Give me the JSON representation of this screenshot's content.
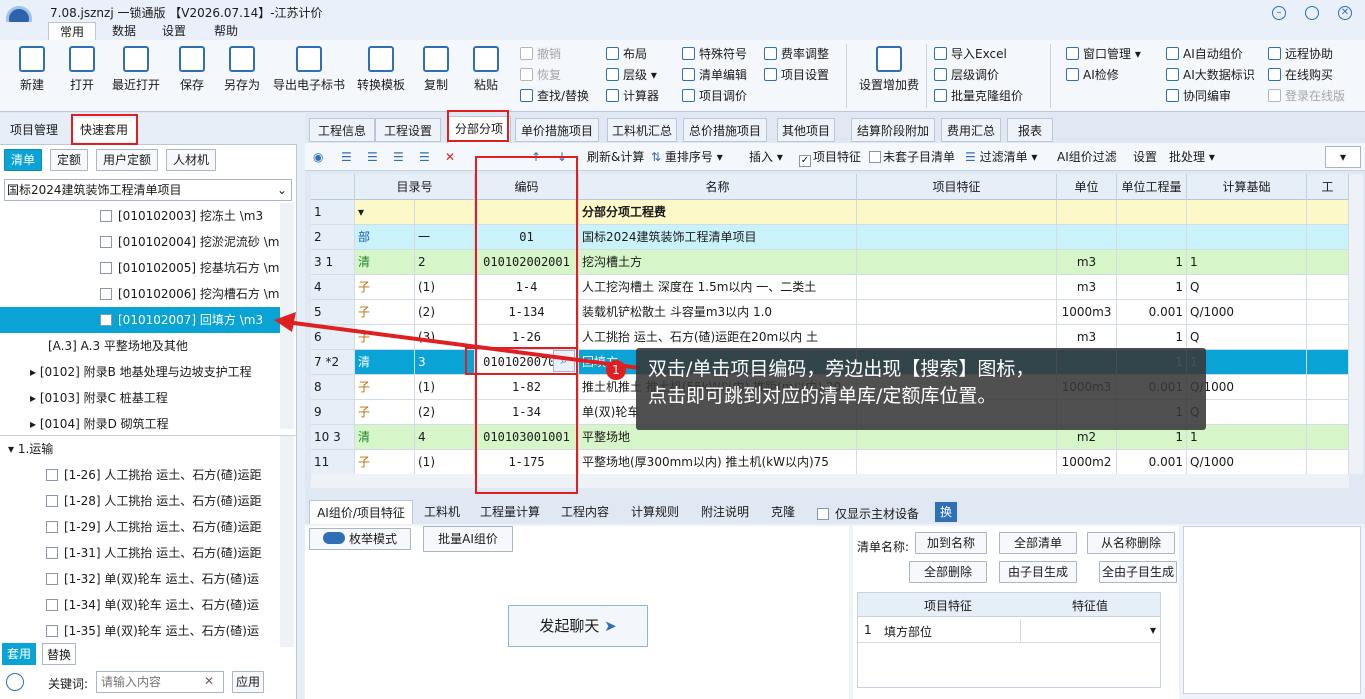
{
  "window": {
    "title": "7.08.jsznzj 一锁通版 【V2026.07.14】-江苏计价"
  },
  "menu": [
    "常用",
    "数据",
    "设置",
    "帮助"
  ],
  "ribbon": {
    "big": [
      "新建",
      "打开",
      "最近打开",
      "保存",
      "另存为",
      "导出电子标书",
      "转换模板",
      "复制",
      "粘贴"
    ],
    "edit": [
      "撤销",
      "恢复",
      "查找/替换"
    ],
    "g2": [
      "布局",
      "层级",
      "计算器"
    ],
    "g3": [
      "特殊符号",
      "清单编辑",
      "项目调价"
    ],
    "g4": [
      "费率调整",
      "项目设置"
    ],
    "add_fee": "设置增加费",
    "g5": [
      "导入Excel",
      "层级调价",
      "批量克隆组价"
    ],
    "g6": [
      "窗口管理",
      "AI检修"
    ],
    "g7": [
      "AI自动组价",
      "AI大数据标识",
      "协同编审"
    ],
    "g8": [
      "远程协助",
      "在线购买",
      "登录在线版"
    ]
  },
  "left": {
    "tabs": [
      "项目管理",
      "快速套用"
    ],
    "subtabs": [
      "清单",
      "定额",
      "用户定额",
      "人材机"
    ],
    "library": "国标2024建筑装饰工程清单项目",
    "tree": [
      "[010102003] 挖冻土 \\m3",
      "[010102004] 挖淤泥流砂 \\m3",
      "[010102005] 挖基坑石方 \\m3",
      "[010102006] 挖沟槽石方 \\m3",
      "[010102007] 回填方 \\m3",
      "[A.3] A.3 平整场地及其他",
      "[0102] 附录B 地基处理与边坡支护工程",
      "[0103] 附录C 桩基工程",
      "[0104] 附录D 砌筑工程"
    ],
    "quota_root": "1.运输",
    "quota": [
      "[1-26] 人工挑抬 运土、石方(碴)运距",
      "[1-28] 人工挑抬 运土、石方(碴)运距",
      "[1-29] 人工挑抬 运土、石方(碴)运距",
      "[1-31] 人工挑抬 运土、石方(碴)运距",
      "[1-32] 单(双)轮车 运土、石方(碴)运",
      "[1-34] 单(双)轮车 运土、石方(碴)运",
      "[1-35] 单(双)轮车 运土、石方(碴)运"
    ],
    "bottom_tabs": [
      "套用",
      "替换"
    ],
    "keyword_label": "关键词:",
    "keyword_placeholder": "请输入内容",
    "clear": "✕",
    "apply": "应用"
  },
  "main_tabs": [
    "工程信息",
    "工程设置",
    "分部分项",
    "单价措施项目",
    "工料机汇总",
    "总价措施项目",
    "其他项目",
    "结算阶段附加",
    "费用汇总",
    "报表"
  ],
  "toolbar": {
    "refresh": "刷新&计算",
    "reorder": "重排序号",
    "insert": "插入",
    "feature": "项目特征",
    "no_quota": "未套子目清单",
    "filter": "过滤清单",
    "ai_filter": "AI组价过滤",
    "settings": "设置",
    "batch": "批处理"
  },
  "grid": {
    "headers": [
      "",
      "目录号",
      "编码",
      "名称",
      "项目特征",
      "单位",
      "单位工程量",
      "计算基础",
      "工"
    ],
    "rows": [
      {
        "no": "1",
        "c1": "",
        "c2": "",
        "code": "",
        "name": "分部分项工程费",
        "unit": "",
        "qty": "",
        "base": "",
        "type": "total"
      },
      {
        "no": "2",
        "c1": "部",
        "c2": "一",
        "code": "01",
        "name": "国标2024建筑装饰工程清单项目",
        "unit": "",
        "qty": "",
        "base": "",
        "type": "part"
      },
      {
        "no": "3  1",
        "c1": "清",
        "c2": "2",
        "code": "010102002001",
        "name": "挖沟槽土方",
        "unit": "m3",
        "qty": "1",
        "base": "1",
        "type": "list"
      },
      {
        "no": "4",
        "c1": "子",
        "c2": "(1)",
        "code": "1-4",
        "name": "人工挖沟槽土 深度在 1.5m以内 一、二类土",
        "unit": "m3",
        "qty": "1",
        "base": "Q",
        "type": "sub"
      },
      {
        "no": "5",
        "c1": "子",
        "c2": "(2)",
        "code": "1-134",
        "name": "装载机铲松散土 斗容量m3以内 1.0",
        "unit": "1000m3",
        "qty": "0.001",
        "base": "Q/1000",
        "type": "sub"
      },
      {
        "no": "6",
        "c1": "子",
        "c2": "(3)",
        "code": "1-26",
        "name": "人工挑抬 运土、石方(碴)运距在20m以内 土",
        "unit": "m3",
        "qty": "1",
        "base": "Q",
        "type": "sub"
      },
      {
        "no": "7 *2",
        "c1": "清",
        "c2": "3",
        "code": "010102007001",
        "name": "回填方",
        "unit": "",
        "qty": "1",
        "base": "1",
        "type": "sel"
      },
      {
        "no": "8",
        "c1": "子",
        "c2": "(1)",
        "code": "1-82",
        "name": "推土机推土 推土机(55kW以内) 推距(m以内) 20",
        "unit": "1000m3",
        "qty": "0.001",
        "base": "Q/1000",
        "type": "sub"
      },
      {
        "no": "9",
        "c1": "子",
        "c2": "(2)",
        "code": "1-34",
        "name": "单(双)轮车",
        "unit": "",
        "qty": "1",
        "base": "Q",
        "type": "sub"
      },
      {
        "no": "10  3",
        "c1": "清",
        "c2": "4",
        "code": "010103001001",
        "name": "平整场地",
        "unit": "m2",
        "qty": "1",
        "base": "1",
        "type": "list"
      },
      {
        "no": "11",
        "c1": "子",
        "c2": "(1)",
        "code": "1-175",
        "name": "平整场地(厚300mm以内) 推土机(kW以内)75",
        "unit": "1000m2",
        "qty": "0.001",
        "base": "Q/1000",
        "type": "sub"
      }
    ]
  },
  "tooltip": {
    "num": "1",
    "line1": "双击/单击项目编码，旁边出现【搜索】图标，",
    "line2": "点击即可跳到对应的清单库/定额库位置。"
  },
  "bottom": {
    "tabs": [
      "AI组价/项目特征",
      "工料机",
      "工程量计算",
      "工程内容",
      "计算规则",
      "附注说明",
      "克隆"
    ],
    "only_main": "仅显示主材设备",
    "swap": "换",
    "enum_mode": "枚举模式",
    "batch_ai": "批量AI组价",
    "chat": "发起聊天",
    "list_name_label": "清单名称:",
    "btns": [
      "加到名称",
      "全部清单",
      "从名称删除",
      "全部删除",
      "由子目生成",
      "全由子目生成"
    ],
    "feat_headers": [
      "项目特征",
      "特征值"
    ],
    "feat_rows": [
      {
        "no": "1",
        "name": "填方部位",
        "value": ""
      }
    ]
  }
}
